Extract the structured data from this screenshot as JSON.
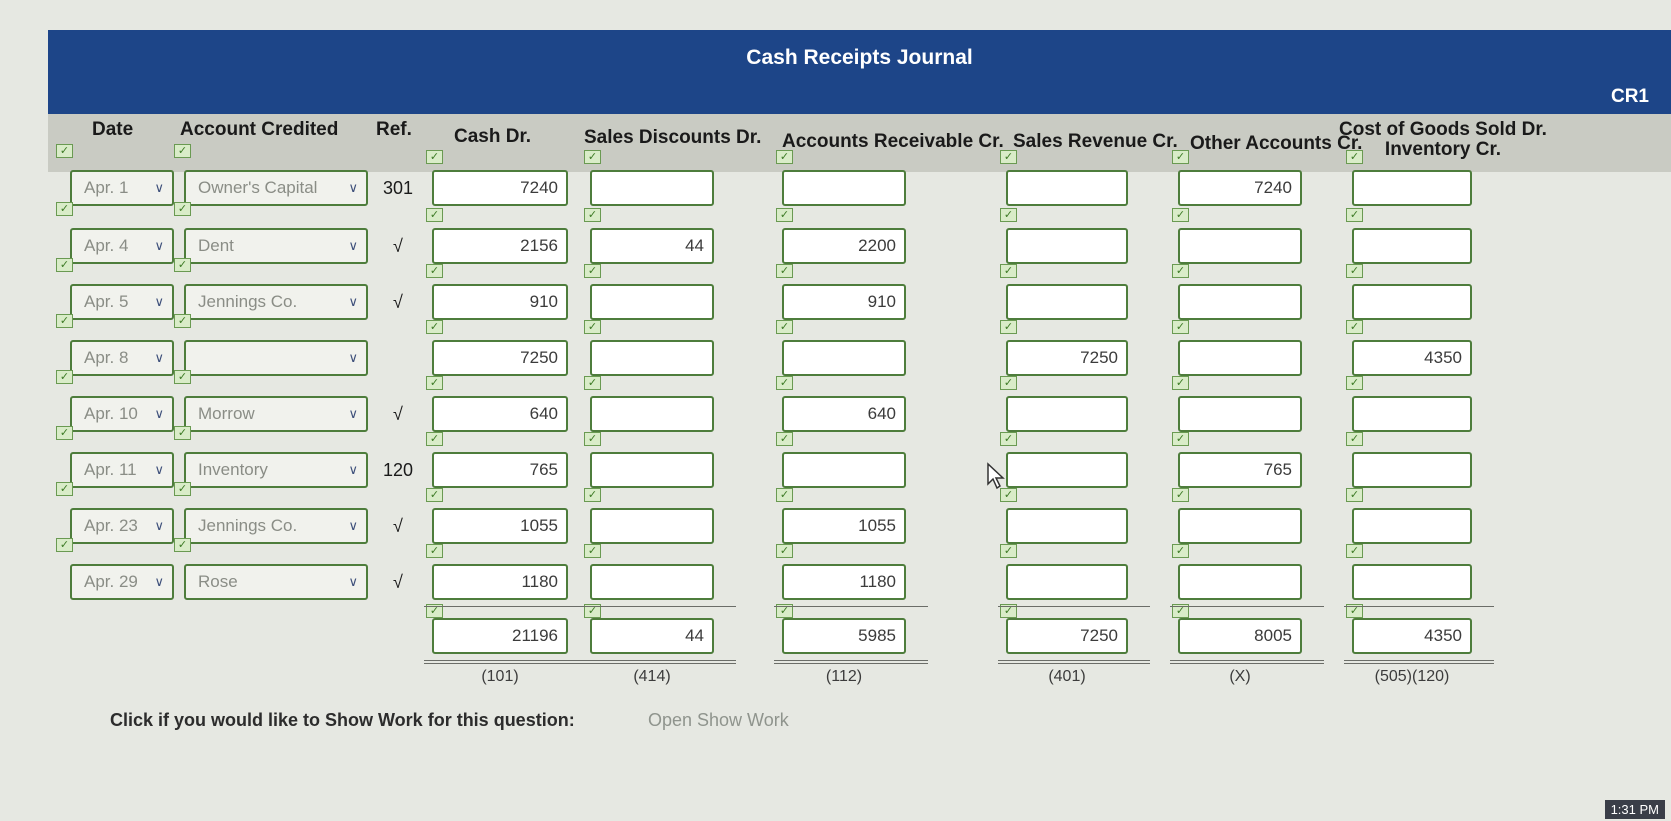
{
  "journal": {
    "title": "Cash Receipts Journal",
    "code": "CR1"
  },
  "headers": {
    "date": "Date",
    "account": "Account Credited",
    "ref": "Ref.",
    "cash": "Cash Dr.",
    "sales_disc": "Sales Discounts Dr.",
    "ar": "Accounts Receivable Cr.",
    "sales_rev": "Sales Revenue Cr.",
    "other": "Other Accounts Cr.",
    "cogs_line1": "Cost of Goods Sold Dr.",
    "cogs_line2": "Inventory Cr."
  },
  "rows": [
    {
      "date": "Apr. 1",
      "account": "Owner's Capital",
      "ref": "301",
      "cash": "7240",
      "disc": "",
      "ar": "",
      "rev": "",
      "other": "7240",
      "cogs": ""
    },
    {
      "date": "Apr. 4",
      "account": "Dent",
      "ref": "√",
      "cash": "2156",
      "disc": "44",
      "ar": "2200",
      "rev": "",
      "other": "",
      "cogs": ""
    },
    {
      "date": "Apr. 5",
      "account": "Jennings Co.",
      "ref": "√",
      "cash": "910",
      "disc": "",
      "ar": "910",
      "rev": "",
      "other": "",
      "cogs": ""
    },
    {
      "date": "Apr. 8",
      "account": "",
      "ref": "",
      "cash": "7250",
      "disc": "",
      "ar": "",
      "rev": "7250",
      "other": "",
      "cogs": "4350"
    },
    {
      "date": "Apr. 10",
      "account": "Morrow",
      "ref": "√",
      "cash": "640",
      "disc": "",
      "ar": "640",
      "rev": "",
      "other": "",
      "cogs": ""
    },
    {
      "date": "Apr. 11",
      "account": "Inventory",
      "ref": "120",
      "cash": "765",
      "disc": "",
      "ar": "",
      "rev": "",
      "other": "765",
      "cogs": ""
    },
    {
      "date": "Apr. 23",
      "account": "Jennings Co.",
      "ref": "√",
      "cash": "1055",
      "disc": "",
      "ar": "1055",
      "rev": "",
      "other": "",
      "cogs": ""
    },
    {
      "date": "Apr. 29",
      "account": "Rose",
      "ref": "√",
      "cash": "1180",
      "disc": "",
      "ar": "1180",
      "rev": "",
      "other": "",
      "cogs": ""
    }
  ],
  "totals": {
    "cash": "21196",
    "disc": "44",
    "ar": "5985",
    "rev": "7250",
    "other": "8005",
    "cogs": "4350"
  },
  "posting_refs": {
    "cash": "(101)",
    "disc": "(414)",
    "ar": "(112)",
    "rev": "(401)",
    "other": "(X)",
    "cogs": "(505)(120)"
  },
  "footer": {
    "prompt": "Click if you would like to Show Work for this question:",
    "link": "Open Show Work"
  },
  "status_bar": {
    "clock": "1:31 PM"
  },
  "colors": {
    "banner": "#1d4588",
    "field_border": "#4e7d3c",
    "check_mark": "#3d7a25"
  }
}
